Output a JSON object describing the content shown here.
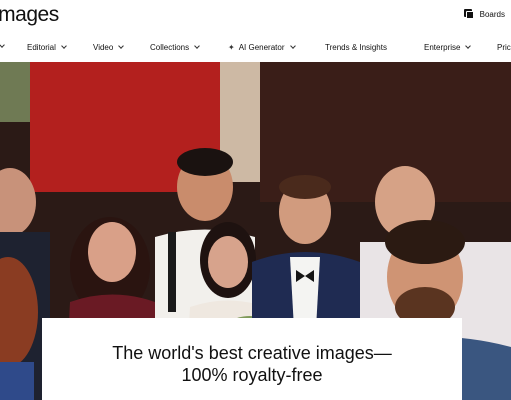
{
  "header": {
    "logo_text": "images",
    "boards_label": "Boards"
  },
  "nav": {
    "items": [
      {
        "label": "Editorial",
        "dropdown": true
      },
      {
        "label": "Video",
        "dropdown": true
      },
      {
        "label": "Collections",
        "dropdown": true
      },
      {
        "label": "AI Generator",
        "dropdown": true
      },
      {
        "label": "Trends & Insights",
        "dropdown": false
      },
      {
        "label": "Enterprise",
        "dropdown": true
      },
      {
        "label": "Pric",
        "dropdown": false
      }
    ],
    "ai_icon": "sparkle-icon"
  },
  "hero": {
    "tagline_line1": "The world's best creative images—",
    "tagline_line2": "100% royalty-free"
  },
  "colors": {
    "background": "#ffffff",
    "text": "#111111"
  }
}
